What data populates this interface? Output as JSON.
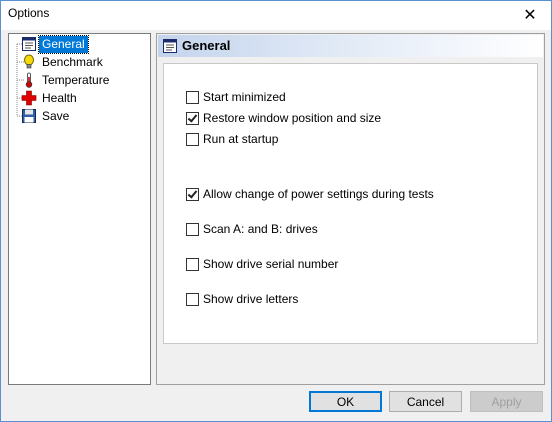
{
  "window": {
    "title": "Options",
    "close_glyph": "✕"
  },
  "tree": {
    "items": [
      {
        "label": "General",
        "icon": "general-page-icon",
        "selected": true
      },
      {
        "label": "Benchmark",
        "icon": "lightbulb-icon",
        "selected": false
      },
      {
        "label": "Temperature",
        "icon": "thermometer-icon",
        "selected": false
      },
      {
        "label": "Health",
        "icon": "red-cross-icon",
        "selected": false
      },
      {
        "label": "Save",
        "icon": "floppy-disk-icon",
        "selected": false
      }
    ]
  },
  "panel": {
    "title": "General",
    "options": [
      {
        "label": "Start minimized",
        "checked": false
      },
      {
        "label": "Restore window position and size",
        "checked": true
      },
      {
        "label": "Run at startup",
        "checked": false
      },
      {
        "label": "Allow change of power settings during tests",
        "checked": true
      },
      {
        "label": "Scan A: and B: drives",
        "checked": false
      },
      {
        "label": "Show drive serial number",
        "checked": false
      },
      {
        "label": "Show drive letters",
        "checked": false
      }
    ]
  },
  "buttons": {
    "ok": "OK",
    "cancel": "Cancel",
    "apply": "Apply"
  },
  "colors": {
    "selection": "#0078d7",
    "border": "#5a8fd1"
  }
}
